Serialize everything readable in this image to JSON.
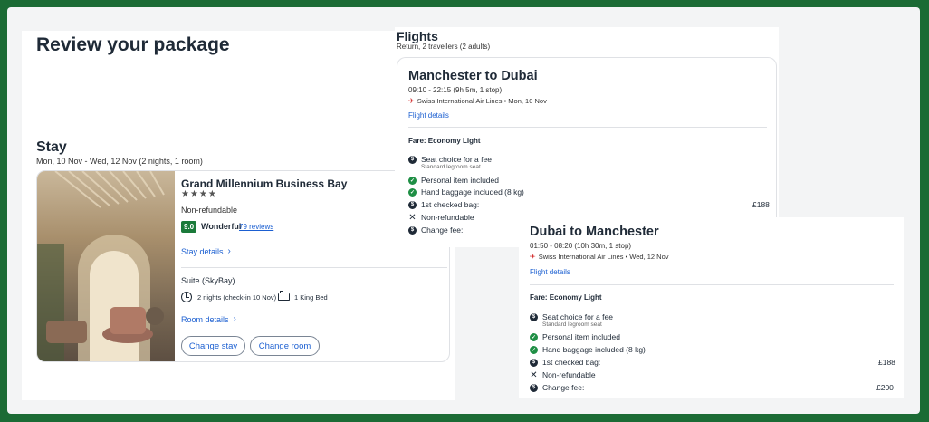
{
  "stay_panel": {
    "page_title": "Review your package",
    "section_title": "Stay",
    "dates": "Mon, 10 Nov - Wed, 12 Nov (2 nights, 1 room)",
    "hotel": {
      "name": "Grand Millennium Business Bay",
      "stars": "★★★★",
      "refund_policy": "Non-refundable",
      "rating_score": "9.0",
      "rating_label": "Wonderful",
      "reviews_link": "79 reviews",
      "stay_details_link": "Stay details",
      "room_name": "Suite (SkyBay)",
      "nights_info": "2 nights (check-in 10 Nov)",
      "bed_info": "1 King Bed",
      "room_details_link": "Room details",
      "change_stay_button": "Change stay",
      "change_room_button": "Change room"
    }
  },
  "flights_panel": {
    "section_title": "Flights",
    "subtitle": "Return, 2 travellers (2 adults)",
    "outbound": {
      "route": "Manchester to Dubai",
      "times": "09:10 - 22:15 (9h 5m, 1 stop)",
      "airline": "Swiss International Air Lines • Mon, 10 Nov",
      "details_link": "Flight details",
      "fare_label": "Fare: Economy Light",
      "features": [
        {
          "icon": "dollar-icon",
          "text": "Seat choice for a fee",
          "note": "Standard legroom seat",
          "price": ""
        },
        {
          "icon": "check-icon",
          "text": "Personal item included",
          "note": "",
          "price": ""
        },
        {
          "icon": "check-icon",
          "text": "Hand baggage included (8 kg)",
          "note": "",
          "price": ""
        },
        {
          "icon": "dollar-icon",
          "text": "1st checked bag:",
          "note": "",
          "price": "£188"
        },
        {
          "icon": "cross-icon",
          "text": "Non-refundable",
          "note": "",
          "price": ""
        },
        {
          "icon": "dollar-icon",
          "text": "Change fee:",
          "note": "",
          "price": ""
        }
      ]
    },
    "return": {
      "route": "Dubai to Manchester",
      "times": "01:50 - 08:20 (10h 30m, 1 stop)",
      "airline": "Swiss International Air Lines • Wed, 12 Nov",
      "details_link": "Flight details",
      "fare_label": "Fare: Economy Light",
      "features": [
        {
          "icon": "dollar-icon",
          "text": "Seat choice for a fee",
          "note": "Standard legroom seat",
          "price": ""
        },
        {
          "icon": "check-icon",
          "text": "Personal item included",
          "note": "",
          "price": ""
        },
        {
          "icon": "check-icon",
          "text": "Hand baggage included (8 kg)",
          "note": "",
          "price": ""
        },
        {
          "icon": "dollar-icon",
          "text": "1st checked bag:",
          "note": "",
          "price": "£188"
        },
        {
          "icon": "cross-icon",
          "text": "Non-refundable",
          "note": "",
          "price": ""
        },
        {
          "icon": "dollar-icon",
          "text": "Change fee:",
          "note": "",
          "price": "£200"
        }
      ]
    }
  },
  "colors": {
    "frame": "#1b6b35",
    "link": "#1b5fd1",
    "rating_badge": "#1b7a3a",
    "check": "#1f8f45"
  }
}
